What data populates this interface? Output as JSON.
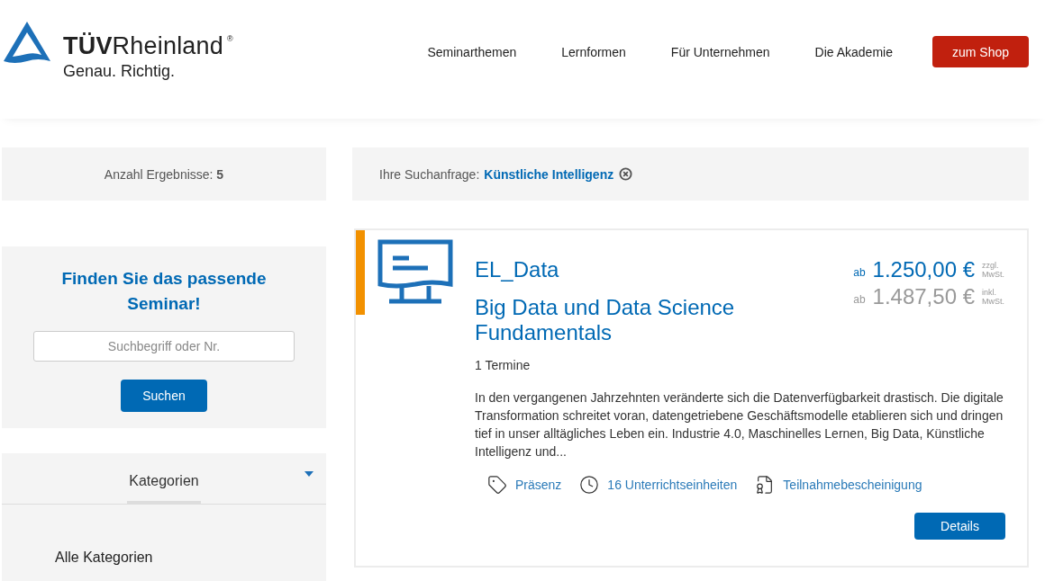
{
  "header": {
    "logo": {
      "brand": "**TÜV**Rheinland",
      "registered": "®",
      "tagline": "Genau. Richtig."
    },
    "nav": [
      "Seminarthemen",
      "Lernformen",
      "Für Unternehmen",
      "Die Akademie"
    ],
    "shop_button": "zum Shop"
  },
  "results_bar": {
    "text": "Anzahl Ergebnisse: **5**"
  },
  "query_bar": {
    "label": "Ihre Suchanfrage:",
    "query": "Künstliche Intelligenz"
  },
  "search_panel": {
    "title": "Finden Sie das passende Seminar!",
    "placeholder": "Suchbegriff oder Nr.",
    "button": "Suchen"
  },
  "categories": {
    "title": "Kategorien",
    "items": [
      "Alle Kategorien"
    ]
  },
  "results": [
    {
      "code": "EL_Data",
      "title": "Big Data und Data Science Fundamentals",
      "sessions": "1 Termine",
      "description": "In den vergangenen Jahrzehnten veränderte sich die Datenverfügbarkeit drastisch. Die digitale Transformation schreitet voran, datengetriebene Geschäftsmodelle etablieren sich und dringen tief in unser alltägliches Leben ein. Industrie 4.0, Maschinelles Lernen, Big Data, Künstliche Intelligenz und...",
      "prices": [
        {
          "kind": "net",
          "prefix": "ab",
          "amount": "1.250,00 €",
          "note": "zzgl. MwSt."
        },
        {
          "kind": "gross",
          "prefix": "ab",
          "amount": "1.487,50 €",
          "note": "inkl. MwSt."
        }
      ],
      "features": [
        {
          "kind": "format",
          "label": "Präsenz"
        },
        {
          "kind": "duration",
          "label": "16 Unterrichtseinheiten"
        },
        {
          "kind": "certificate",
          "label": "Teilnahmebescheinigung"
        }
      ],
      "button": "Details"
    }
  ]
}
